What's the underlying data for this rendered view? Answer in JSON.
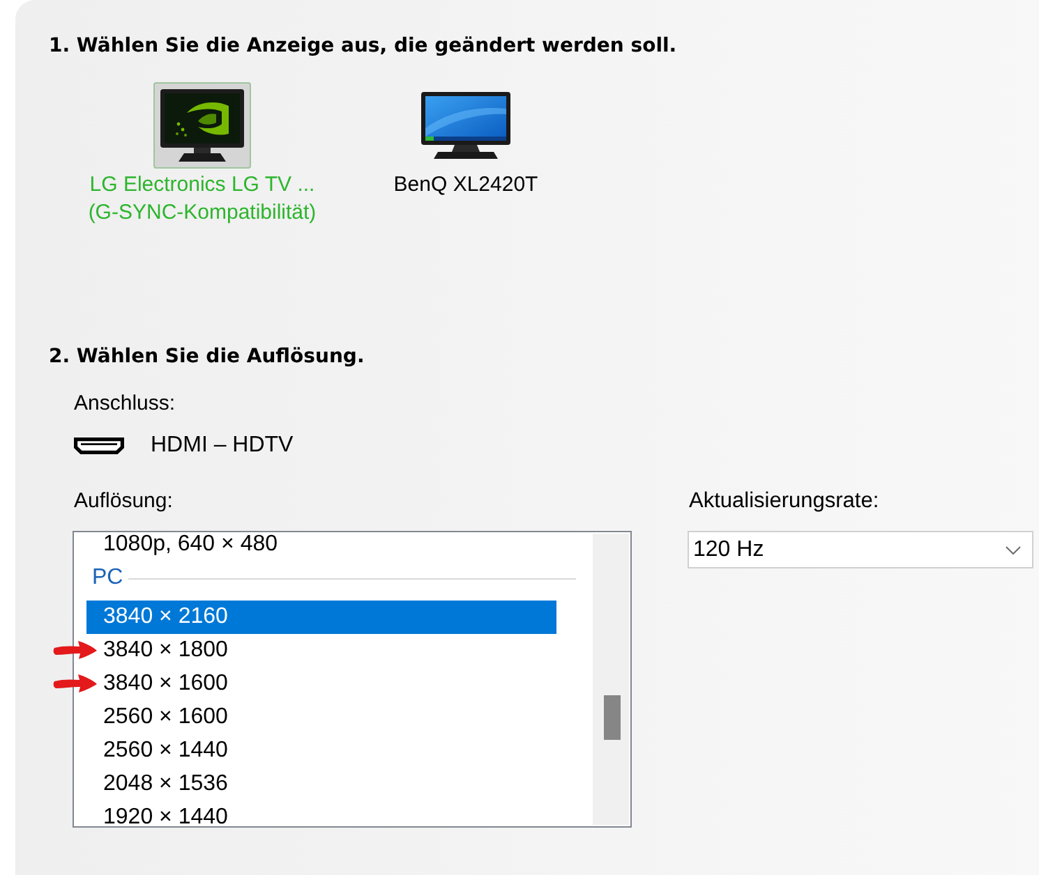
{
  "section_1": {
    "heading": "1. Wählen Sie die Anzeige aus, die geändert werden soll.",
    "displays": [
      {
        "kind": "logo",
        "name": "LG Electronics LG TV ...",
        "note": "(G-SYNC-Kompatibilität)",
        "selected": true
      },
      {
        "kind": "desktop",
        "name": "BenQ XL2420T",
        "selected": false
      }
    ]
  },
  "section_2": {
    "heading": "2. Wählen Sie die Auflösung.",
    "connection": {
      "label": "Anschluss:",
      "value": "HDMI – HDTV"
    },
    "resolution": {
      "label": "Auflösung:",
      "items": [
        {
          "kind": "item",
          "text": "1080p, 640 × 480",
          "selected": false,
          "marked": false
        },
        {
          "kind": "group",
          "text": "PC"
        },
        {
          "kind": "item",
          "text": "3840 × 2160",
          "selected": true,
          "marked": false
        },
        {
          "kind": "item",
          "text": "3840 × 1800",
          "selected": false,
          "marked": true
        },
        {
          "kind": "item",
          "text": "3840 × 1600",
          "selected": false,
          "marked": true
        },
        {
          "kind": "item",
          "text": "2560 × 1600",
          "selected": false,
          "marked": false
        },
        {
          "kind": "item",
          "text": "2560 × 1440",
          "selected": false,
          "marked": false
        },
        {
          "kind": "item",
          "text": "2048 × 1536",
          "selected": false,
          "marked": false
        },
        {
          "kind": "item",
          "text": "1920 × 1440",
          "selected": false,
          "marked": false
        }
      ]
    },
    "refresh_rate": {
      "label": "Aktualisierungsrate:",
      "value": "120 Hz"
    }
  }
}
